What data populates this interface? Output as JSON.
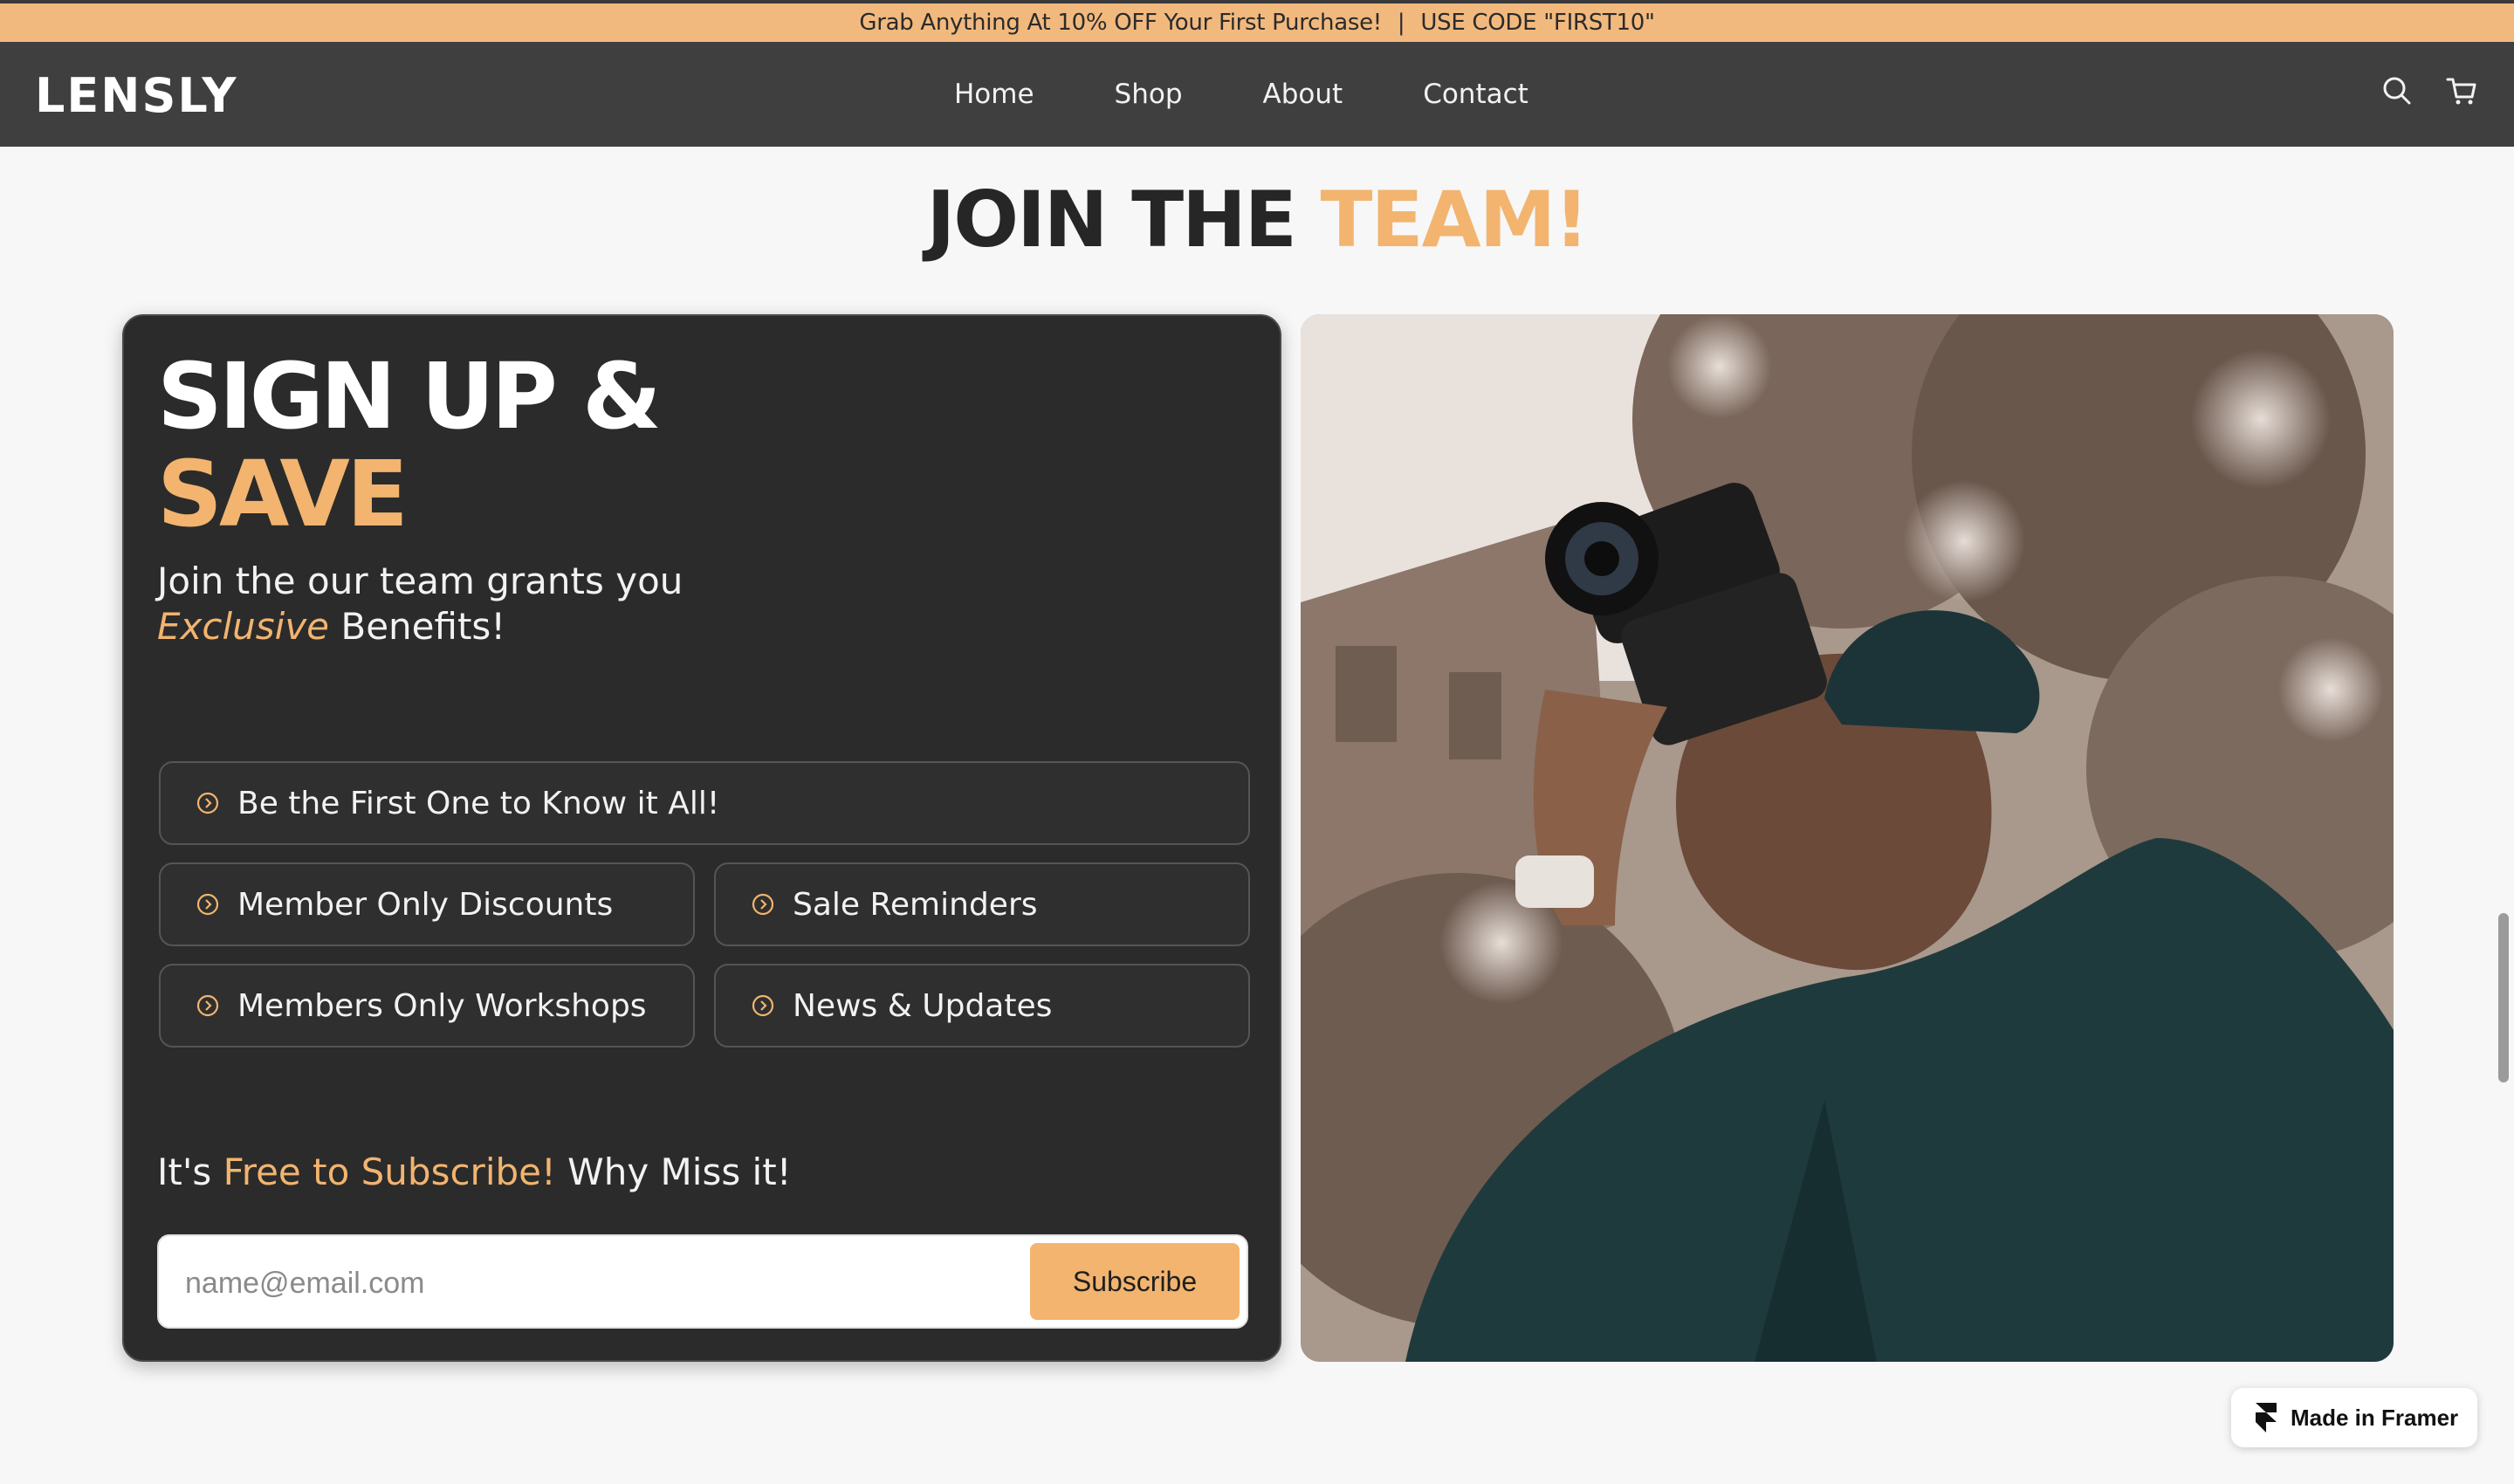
{
  "promo": {
    "message": "Grab Anything At 10% OFF Your First Purchase!",
    "separator": "|",
    "code_text": "USE CODE \"FIRST10\""
  },
  "nav": {
    "logo": "LENSLY",
    "links": [
      "Home",
      "Shop",
      "About",
      "Contact"
    ],
    "icons": [
      "search-icon",
      "cart-icon"
    ]
  },
  "hero": {
    "title_main": "JOIN THE ",
    "title_accent": "TEAM!"
  },
  "card": {
    "heading_line1": "SIGN UP &",
    "heading_line2": "SAVE",
    "subtitle_line1": "Join the our team grants you",
    "subtitle_em": "Exclusive",
    "subtitle_rest": " Benefits!",
    "benefits": [
      "Be the First One to Know it All!",
      "Member Only Discounts",
      "Sale Reminders",
      "Members Only Workshops",
      "News & Updates"
    ],
    "free_prefix": "It's ",
    "free_accent": "Free to Subscribe!",
    "free_suffix": " Why Miss it!",
    "email_placeholder": "name@email.com",
    "subscribe_label": "Subscribe"
  },
  "badge": {
    "label": "Made in Framer"
  },
  "colors": {
    "accent": "#f2b46f",
    "promo_bg": "#f2b97e",
    "nav_bg": "#3f3f3f",
    "card_bg": "#2b2b2b"
  }
}
